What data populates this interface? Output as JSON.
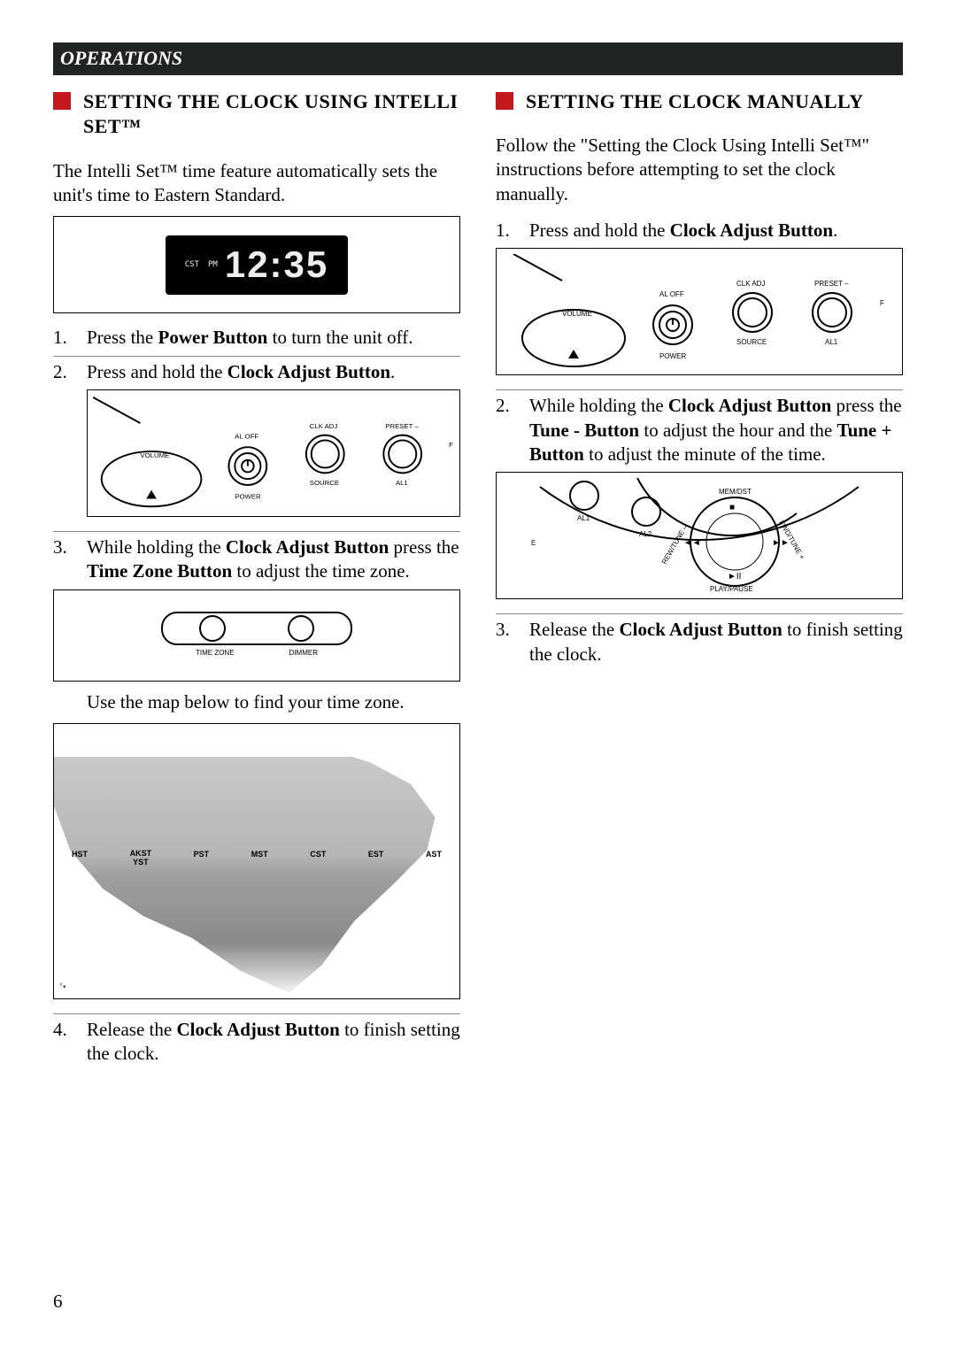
{
  "section_title": "OPERATIONS",
  "page_number": "6",
  "left": {
    "heading": "SETTING THE CLOCK USING INTELLI SET™",
    "intro": "The Intelli Set™ time feature automatically sets the unit's time to Eastern Standard.",
    "clock": {
      "tz": "CST",
      "ampm": "PM",
      "time": "12:35"
    },
    "steps": {
      "s1_a": "Press the ",
      "s1_b": "Power Button",
      "s1_c": " to turn the unit off.",
      "s2_a": "Press and hold the ",
      "s2_b": "Clock Adjust Button",
      "s2_c": ".",
      "s3_a": "While holding the ",
      "s3_b": "Clock Adjust Button",
      "s3_c": " press the ",
      "s3_d": "Time Zone Button",
      "s3_e": " to adjust the time zone.",
      "s3_note": "Use the map below to find your time zone.",
      "s4_a": "Release the ",
      "s4_b": "Clock Adjust Button",
      "s4_c": " to finish setting the clock."
    },
    "panel": {
      "volume": "VOLUME",
      "al_off": "AL OFF",
      "power": "POWER",
      "clk_adj": "CLK ADJ",
      "source": "SOURCE",
      "preset_minus": "PRESET –",
      "al1": "AL1"
    },
    "tz_fig": {
      "time_zone": "TIME ZONE",
      "dimmer": "DIMMER"
    },
    "map_zones": [
      "HST",
      "AKST",
      "YST",
      "PST",
      "MST",
      "CST",
      "EST",
      "AST"
    ]
  },
  "right": {
    "heading": "SETTING THE CLOCK MANUALLY",
    "intro": "Follow the \"Setting the Clock Using Intelli Set™\" instructions before attempting to set the clock manually.",
    "steps": {
      "s1_a": "Press and hold the ",
      "s1_b": "Clock Adjust Button",
      "s1_c": ".",
      "s2_a": "While holding the ",
      "s2_b": "Clock Adjust Button",
      "s2_c": " press the ",
      "s2_d": "Tune - Button",
      "s2_e": " to adjust the hour and the ",
      "s2_f": "Tune + Button",
      "s2_g": " to adjust the minute of the time.",
      "s3_a": "Release the ",
      "s3_b": "Clock Adjust Button",
      "s3_c": " to finish setting the clock."
    },
    "panel": {
      "volume": "VOLUME",
      "al_off": "AL OFF",
      "power": "POWER",
      "clk_adj": "CLK ADJ",
      "source": "SOURCE",
      "preset_minus": "PRESET –",
      "al1": "AL1"
    },
    "circ": {
      "al1": "AL1",
      "al2": "AL2",
      "mem_dst": "MEM/DST",
      "rew_tune_minus": "REW/TUNE –",
      "fwd_tune_plus": "FWD/TUNE +",
      "play_pause": "PLAY/PAUSE",
      "prev": "◄◄",
      "next": "►►",
      "stop": "■",
      "play": "►II"
    }
  }
}
